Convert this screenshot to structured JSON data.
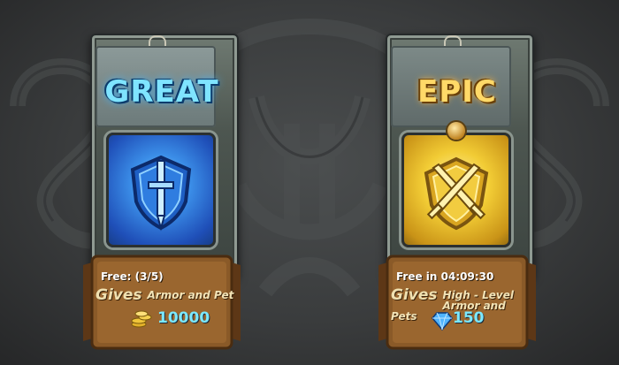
{
  "chests": [
    {
      "id": "great",
      "title": "GREAT",
      "free_label": "Free: (3/5)",
      "gives_word": "Gives",
      "gives_desc": "Armor and Pet",
      "price": "10000",
      "currency_icon": "gold-coins-icon",
      "theme_color": "#3b8ee8"
    },
    {
      "id": "epic",
      "title": "EPIC",
      "free_label": "Free in 04:09:30",
      "gives_word": "Gives",
      "gives_desc": "High - Level Armor and Pets",
      "price": "150",
      "currency_icon": "diamond-icon",
      "theme_color": "#f2cc35"
    }
  ],
  "colors": {
    "background": "#3a3c3d",
    "price_text": "#7be8ff",
    "scroll": "#8a5a28"
  }
}
